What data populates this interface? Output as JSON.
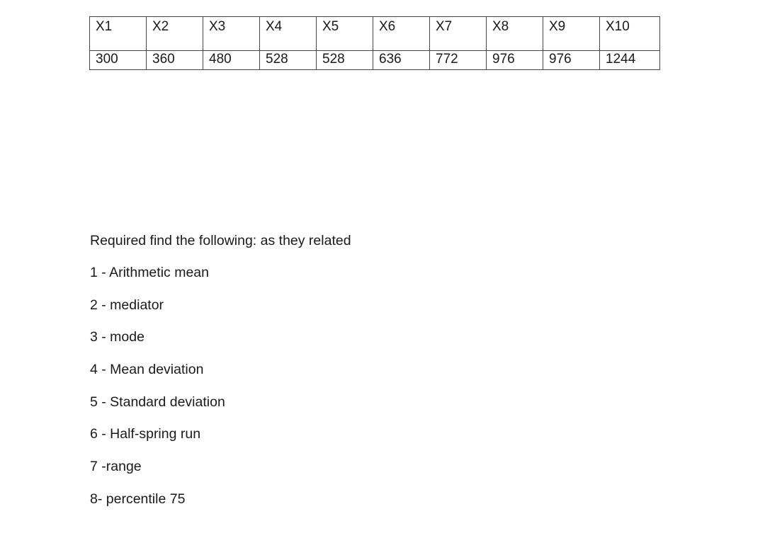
{
  "table": {
    "headers": [
      "X1",
      "X2",
      "X3",
      "X4",
      "X5",
      "X6",
      "X7",
      "X8",
      "X9",
      "X10"
    ],
    "values": [
      "300",
      "360",
      "480",
      "528",
      "528",
      "636",
      "772",
      "976",
      "976",
      "1244"
    ]
  },
  "intro": "Required find the following:  as they related",
  "items": [
    "1 - Arithmetic mean",
    "2 - mediator",
    "3 - mode",
    "4 - Mean deviation",
    "5 - Standard deviation",
    "6 - Half-spring run",
    "7 -range",
    "8- percentile 75"
  ]
}
